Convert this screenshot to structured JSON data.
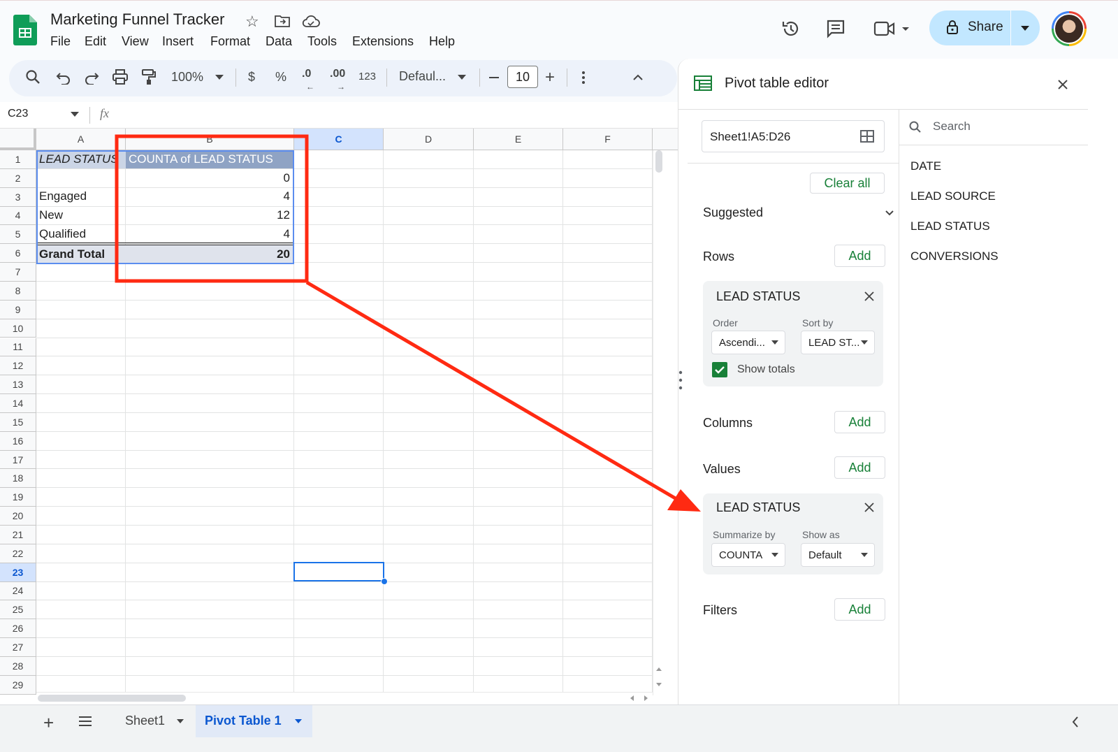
{
  "app": {
    "title": "Marketing Funnel Tracker",
    "menu": [
      "File",
      "Edit",
      "View",
      "Insert",
      "Format",
      "Data",
      "Tools",
      "Extensions",
      "Help"
    ],
    "share_label": "Share"
  },
  "toolbar": {
    "zoom": "100%",
    "currency": "$",
    "percent": "%",
    "dec_dec": ".0",
    "dec_inc": ".00",
    "number_format": "123",
    "font": "Defaul...",
    "font_size": "10"
  },
  "formula_bar": {
    "name_box": "C23",
    "fx": "fx",
    "content": ""
  },
  "grid": {
    "columns": [
      "A",
      "B",
      "C",
      "D",
      "E",
      "F"
    ],
    "rows": [
      "1",
      "2",
      "3",
      "4",
      "5",
      "6",
      "7",
      "8",
      "9",
      "10",
      "11",
      "12",
      "13",
      "14",
      "15",
      "16",
      "17",
      "18",
      "19",
      "20",
      "21",
      "22",
      "23",
      "24",
      "25",
      "26",
      "27",
      "28",
      "29"
    ],
    "selected_cell": "C23",
    "header_row": {
      "a": "LEAD STATUS",
      "b": "COUNTA of LEAD STATUS"
    },
    "data_rows": [
      {
        "a": "",
        "b": "0"
      },
      {
        "a": "Engaged",
        "b": "4"
      },
      {
        "a": "New",
        "b": "12"
      },
      {
        "a": "Qualified",
        "b": "4"
      }
    ],
    "total_row": {
      "a": "Grand Total",
      "b": "20"
    }
  },
  "sheets": {
    "tabs": [
      {
        "label": "Sheet1",
        "active": false
      },
      {
        "label": "Pivot Table 1",
        "active": true
      }
    ]
  },
  "pivot_editor": {
    "title": "Pivot table editor",
    "range": "Sheet1!A5:D26",
    "clear_all": "Clear all",
    "suggested": "Suggested",
    "add_label": "Add",
    "rows_label": "Rows",
    "columns_label": "Columns",
    "values_label": "Values",
    "filters_label": "Filters",
    "row_card": {
      "field": "LEAD STATUS",
      "order_label": "Order",
      "order_value": "Ascendi...",
      "sort_label": "Sort by",
      "sort_value": "LEAD ST...",
      "show_totals": "Show totals",
      "show_totals_checked": true
    },
    "value_card": {
      "field": "LEAD STATUS",
      "summarize_label": "Summarize by",
      "summarize_value": "COUNTA",
      "show_as_label": "Show as",
      "show_as_value": "Default"
    },
    "search_placeholder": "Search",
    "fields": [
      "DATE",
      "LEAD SOURCE",
      "LEAD STATUS",
      "CONVERSIONS"
    ]
  },
  "annotation": {
    "color": "#ff2a12"
  }
}
